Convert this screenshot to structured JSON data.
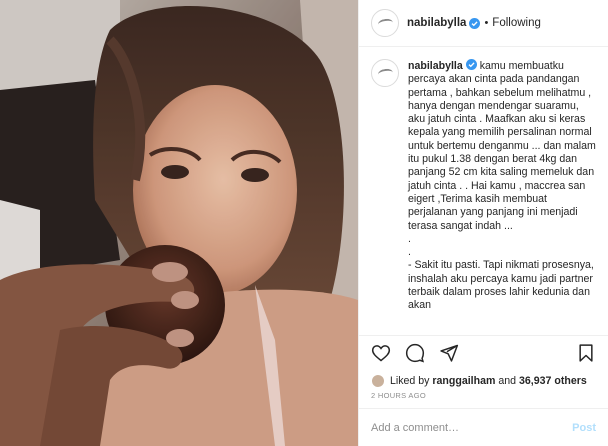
{
  "header": {
    "username": "nabilabylla",
    "separator": "•",
    "follow_status": "Following"
  },
  "caption": {
    "username": "nabilabylla",
    "text": "kamu membuatku percaya akan cinta pada pandangan pertama , bahkan sebelum melihatmu , hanya dengan mendengar suaramu, aku jatuh cinta . Maafkan aku si keras kepala yang memilih persalinan normal untuk bertemu denganmu ... dan malam itu pukul 1.38 dengan berat 4kg dan panjang 52 cm kita saling memeluk dan jatuh cinta . . Hai kamu , maccrea san eigert ,Terima kasih membuat perjalanan yang panjang ini menjadi terasa sangat indah ...\n.\n.\n- Sakit itu pasti. Tapi nikmati prosesnya, inshalah aku percaya kamu jadi partner terbaik dalam proses lahir kedunia dan akan"
  },
  "actions": {
    "like": "heart-icon",
    "comment": "comment-icon",
    "share": "share-icon",
    "save": "bookmark-icon"
  },
  "likes": {
    "prefix": "Liked by",
    "first_user": "ranggailham",
    "connector": "and",
    "others": "36,937 others"
  },
  "timestamp": "2 HOURS AGO",
  "comment_box": {
    "placeholder": "Add a comment…",
    "post_label": "Post"
  },
  "colors": {
    "verified_badge": "#3897f0",
    "post_button_disabled": "#b2dffc",
    "muted_text": "#8e8e8e"
  }
}
